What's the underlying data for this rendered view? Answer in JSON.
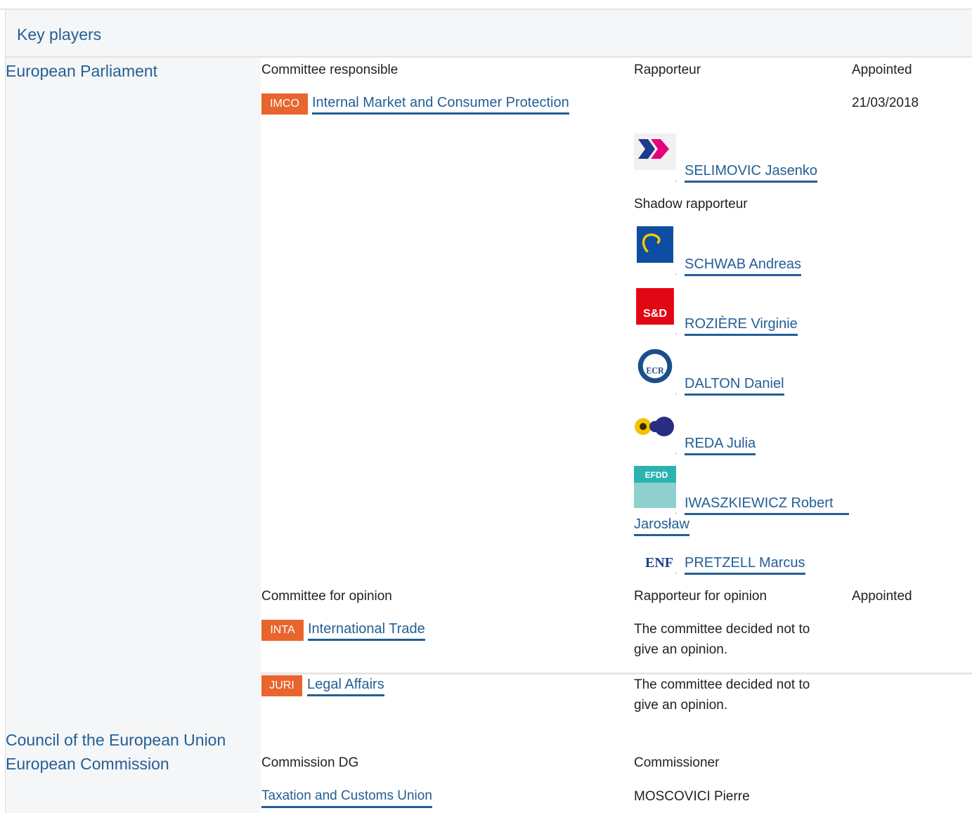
{
  "header": {
    "title": "Key players"
  },
  "institutions": {
    "ep": "European Parliament",
    "council": "Council of the European Union",
    "commission": "European Commission"
  },
  "responsible": {
    "col_committee": "Committee responsible",
    "col_rapporteur": "Rapporteur",
    "col_appointed": "Appointed",
    "committee_code": "IMCO",
    "committee_name": "Internal Market and Consumer Protection",
    "appointed_date": "21/03/2018",
    "rapporteur": "SELIMOVIC Jasenko",
    "shadow_label": "Shadow rapporteur",
    "shadows": [
      {
        "name": "SCHWAB Andreas",
        "logo": "epp-logo"
      },
      {
        "name": "ROZIÈRE Virginie",
        "logo": "s-and-d-logo",
        "logo_text": "S&D"
      },
      {
        "name": "DALTON Daniel",
        "logo": "ecr-logo",
        "logo_text": "ECR"
      },
      {
        "name": "REDA Julia",
        "logo": "greens-efa-logo"
      },
      {
        "name_line1": "IWASZKIEWICZ Robert",
        "name_line2": "Jarosław",
        "logo": "efdd-logo",
        "logo_text": "EFDD"
      },
      {
        "name": "PRETZELL Marcus",
        "logo": "enf-logo",
        "logo_text": "ENF"
      }
    ]
  },
  "opinion": {
    "col_committee": "Committee for opinion",
    "col_rapporteur": "Rapporteur for opinion",
    "col_appointed": "Appointed",
    "rows": [
      {
        "code": "INTA",
        "name": "International Trade",
        "note_line1": "The committee decided not to",
        "note_line2": "give an opinion."
      },
      {
        "code": "JURI",
        "name": "Legal Affairs",
        "note_line1": "The committee decided not to",
        "note_line2": "give an opinion."
      }
    ]
  },
  "commission": {
    "col_dg": "Commission DG",
    "col_commissioner": "Commissioner",
    "dg": "Taxation and Customs Union",
    "commissioner": "MOSCOVICI Pierre"
  },
  "colors": {
    "link": "#235f96",
    "tag": "#e8652e",
    "panel": "#f5f6f7"
  }
}
